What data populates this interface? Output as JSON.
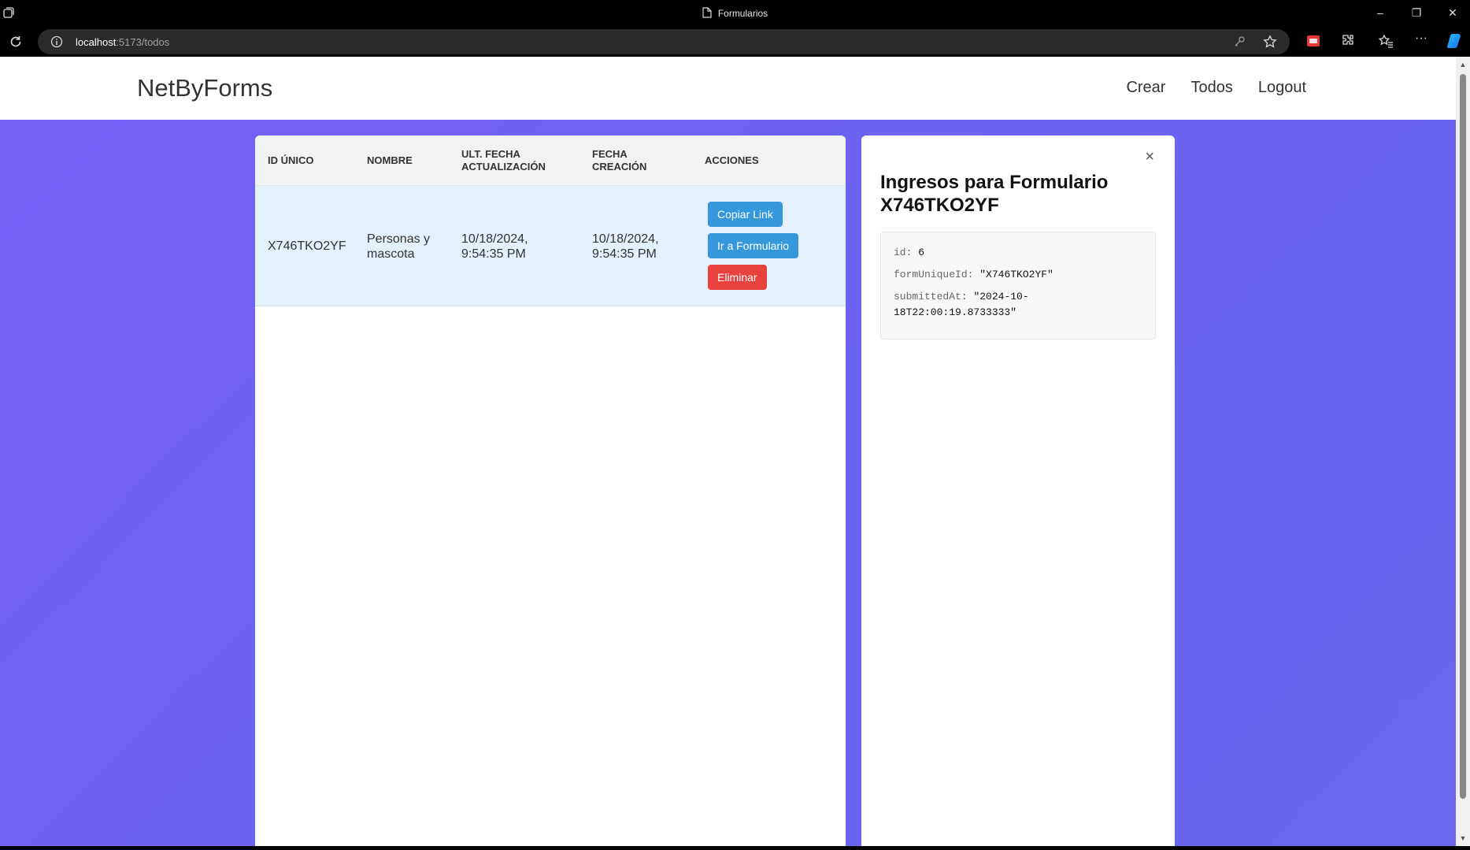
{
  "browser": {
    "window_title": "Formularios",
    "url_host": "localhost",
    "url_path": ":5173/todos"
  },
  "navbar": {
    "brand": "NetByForms",
    "links": [
      "Crear",
      "Todos",
      "Logout"
    ]
  },
  "table": {
    "headers": {
      "id": "ID ÚNICO",
      "nombre": "NOMBRE",
      "ult_fecha_line1": "ULT. FECHA",
      "ult_fecha_line2": "ACTUALIZACIÓN",
      "fecha_line1": "FECHA",
      "fecha_line2": "CREACIÓN",
      "acciones": "ACCIONES"
    },
    "rows": [
      {
        "id": "X746TKO2YF",
        "nombre_line1": "Personas y",
        "nombre_line2": "mascota",
        "updated_line1": "10/18/2024,",
        "updated_line2": "9:54:35 PM",
        "created_line1": "10/18/2024,",
        "created_line2": "9:54:35 PM",
        "actions": {
          "copy": "Copiar Link",
          "goto": "Ir a Formulario",
          "delete": "Eliminar"
        }
      }
    ]
  },
  "panel": {
    "close": "×",
    "title": "Ingresos para Formulario X746TKO2YF",
    "entries": [
      {
        "key": "id:",
        "value": "6"
      },
      {
        "key": "formUniqueId:",
        "value": "\"X746TKO2YF\""
      },
      {
        "key": "submittedAt:",
        "value": "\"2024-10-"
      },
      {
        "key": "",
        "value": "18T22:00:19.8733333\""
      }
    ]
  },
  "colors": {
    "background_gradient_start": "#7660f4",
    "background_gradient_end": "#6a66ef",
    "button_blue": "#3498db",
    "button_red": "#e8413e",
    "row_highlight": "#e4f0fb"
  }
}
